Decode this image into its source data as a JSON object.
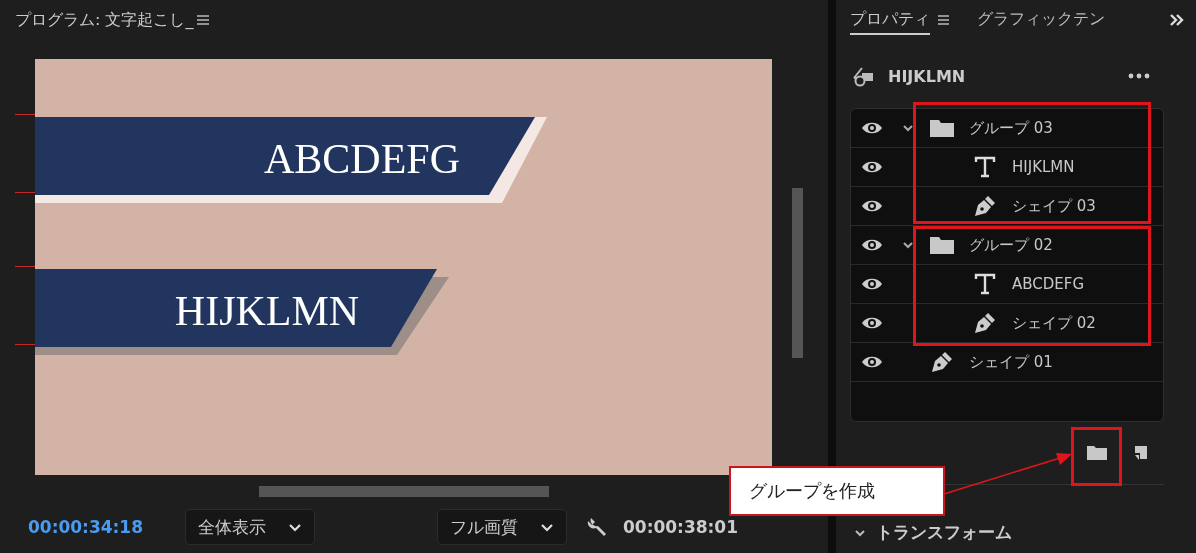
{
  "program_monitor": {
    "title": "プログラム: 文字起こし_",
    "preview": {
      "banners": [
        {
          "text": "ABCDEFG",
          "kind": "stripe"
        },
        {
          "text": "HIJKLMN",
          "kind": "shadow"
        }
      ]
    },
    "timecode": "00:00:34:18",
    "zoom_dropdown": "全体表示",
    "quality_dropdown": "フル画質",
    "duration": "00:00:38:01"
  },
  "panel": {
    "tabs": [
      {
        "label": "プロパティ",
        "selected": true
      },
      {
        "label": "グラフィックテン",
        "selected": false
      }
    ],
    "title": "HIJKLMN",
    "layers": [
      {
        "name": "グループ 03",
        "kind": "group",
        "visible": true,
        "expanded": true,
        "children": [
          {
            "name": "HIJKLMN",
            "kind": "text",
            "visible": true
          },
          {
            "name": "シェイプ 03",
            "kind": "shape",
            "visible": true
          }
        ]
      },
      {
        "name": "グループ 02",
        "kind": "group",
        "visible": true,
        "expanded": true,
        "children": [
          {
            "name": "ABCDEFG",
            "kind": "text",
            "visible": true
          },
          {
            "name": "シェイプ 02",
            "kind": "shape",
            "visible": true
          }
        ]
      },
      {
        "name": "シェイプ 01",
        "kind": "shape",
        "visible": true
      }
    ],
    "section": {
      "label": "トランスフォーム",
      "expanded": true
    }
  },
  "annotation": {
    "callout": "グループを作成"
  }
}
